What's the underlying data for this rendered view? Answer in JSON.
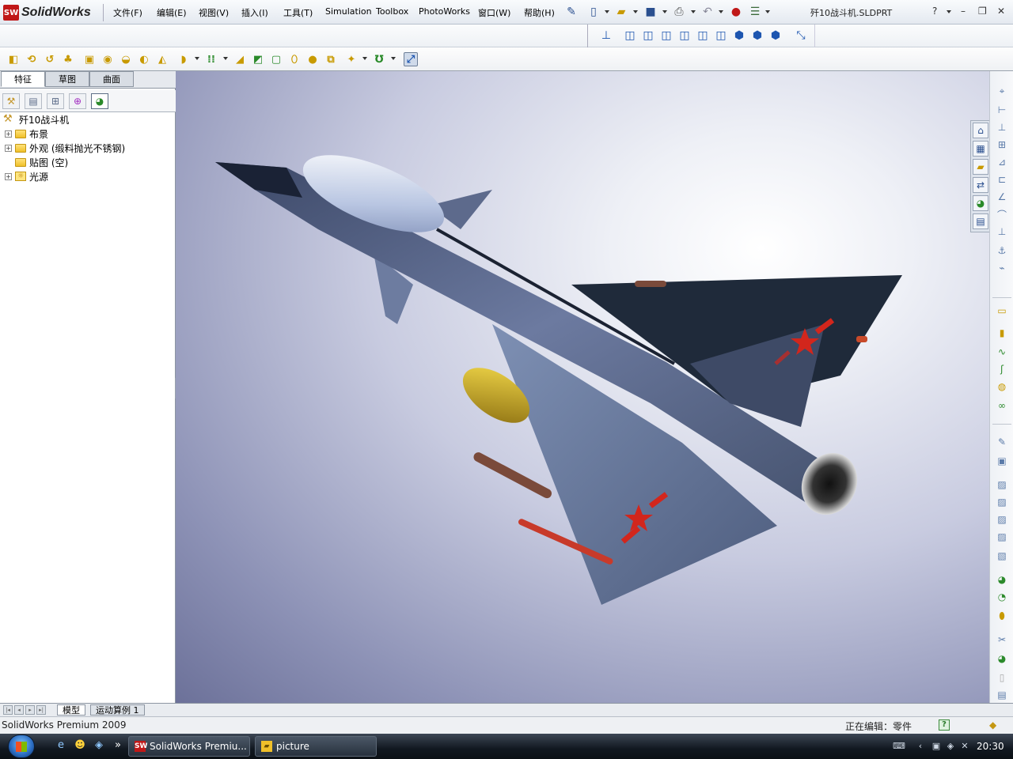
{
  "app": {
    "logo_text": "SolidWorks",
    "doc_title": "歼10战斗机.SLDPRT"
  },
  "menu": [
    "文件(F)",
    "编辑(E)",
    "视图(V)",
    "插入(I)",
    "工具(T)",
    "Simulation",
    "Toolbox",
    "PhotoWorks",
    "窗口(W)",
    "帮助(H)"
  ],
  "command_tabs": [
    "特征",
    "草图",
    "曲面"
  ],
  "feature_tree": {
    "root": "歼10战斗机",
    "items": [
      {
        "label": "布景",
        "expandable": true
      },
      {
        "label": "外观 (缎料抛光不锈钢)",
        "expandable": true
      },
      {
        "label": "贴图 (空)",
        "expandable": false
      },
      {
        "label": "光源",
        "expandable": true
      }
    ]
  },
  "bottom_tabs": [
    "模型",
    "运动算例 1"
  ],
  "status": {
    "left": "SolidWorks Premium 2009",
    "right": "正在编辑：零件"
  },
  "taskbar": {
    "tasks": [
      "SolidWorks Premiu...",
      "picture"
    ],
    "clock": "20:30"
  },
  "colors": {
    "accent": "#1e56b0",
    "jet_body": "#5d6a8c",
    "jet_dark": "#1f2a3a",
    "insignia": "#d2261c",
    "fuel_tank": "#c9a51c"
  }
}
